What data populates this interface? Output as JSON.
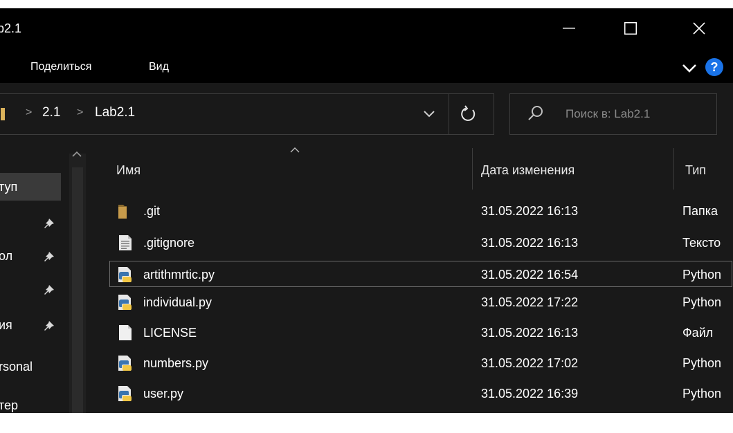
{
  "window": {
    "title": "b2.1",
    "minimize_icon": "minimize-icon",
    "maximize_icon": "maximize-icon",
    "close_icon": "close-icon"
  },
  "ribbon": {
    "tabs": [
      "Поделиться",
      "Вид"
    ],
    "help_label": "?"
  },
  "address": {
    "crumbs": [
      "2.1",
      "Lab2.1"
    ],
    "separator": ">"
  },
  "search": {
    "placeholder": "Поиск в: Lab2.1"
  },
  "nav": {
    "items": [
      {
        "label": "туп",
        "pinned": false,
        "selected": true
      },
      {
        "label": "",
        "pinned": true,
        "selected": false
      },
      {
        "label": "ол",
        "pinned": true,
        "selected": false
      },
      {
        "label": "",
        "pinned": true,
        "selected": false
      },
      {
        "label": "ия",
        "pinned": true,
        "selected": false
      },
      {
        "label": "rsonal",
        "pinned": false,
        "selected": false
      },
      {
        "label": "тер",
        "pinned": false,
        "selected": false
      }
    ]
  },
  "columns": {
    "name": "Имя",
    "date": "Дата изменения",
    "type": "Тип"
  },
  "files": [
    {
      "name": ".git",
      "date": "31.05.2022 16:13",
      "type": "Папка",
      "icon": "folder-icon"
    },
    {
      "name": ".gitignore",
      "date": "31.05.2022 16:13",
      "type": "Тексто",
      "icon": "text-file-icon"
    },
    {
      "name": "artithmrtic.py",
      "date": "31.05.2022 16:54",
      "type": "Python",
      "icon": "python-file-icon"
    },
    {
      "name": "individual.py",
      "date": "31.05.2022 17:22",
      "type": "Python",
      "icon": "python-file-icon"
    },
    {
      "name": "LICENSE",
      "date": "31.05.2022 16:13",
      "type": "Файл",
      "icon": "blank-file-icon"
    },
    {
      "name": "numbers.py",
      "date": "31.05.2022 17:02",
      "type": "Python",
      "icon": "python-file-icon"
    },
    {
      "name": "user.py",
      "date": "31.05.2022 16:39",
      "type": "Python",
      "icon": "python-file-icon"
    }
  ],
  "colors": {
    "window_bg": "#191919",
    "titlebar_bg": "#000000",
    "folder": "#dcb35c",
    "help_blue": "#1a73e8",
    "python_blue": "#3a75b0",
    "python_yellow": "#f2c744"
  }
}
